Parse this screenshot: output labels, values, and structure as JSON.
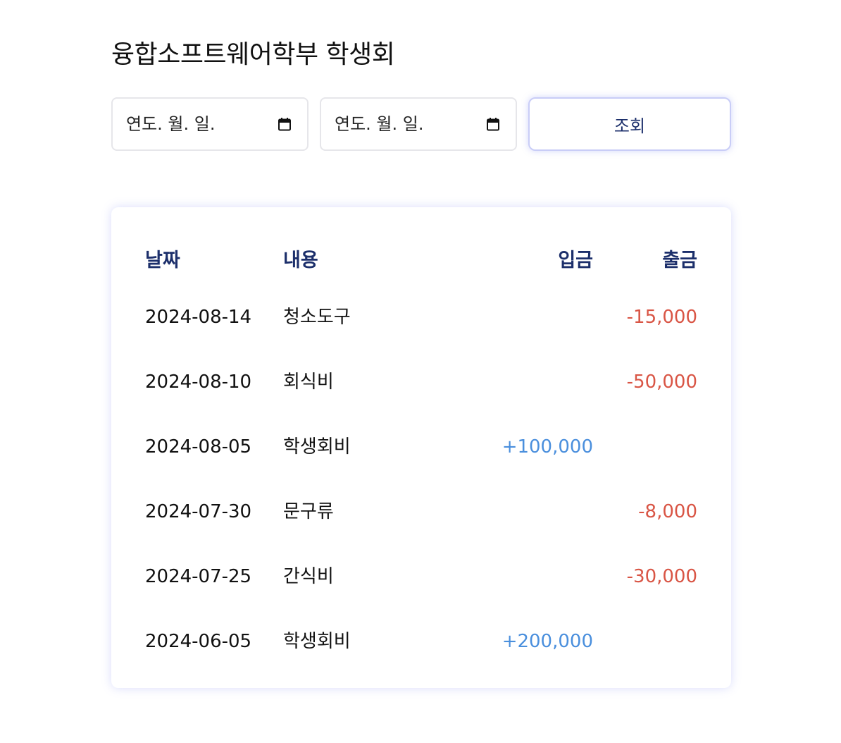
{
  "title": "융합소프트웨어학부 학생회",
  "filters": {
    "start_date_placeholder": "연도. 월. 일.",
    "end_date_placeholder": "연도. 월. 일.",
    "calendar_icon": "calendar-icon",
    "search_label": "조회"
  },
  "table": {
    "headers": {
      "date": "날짜",
      "description": "내용",
      "deposit": "입금",
      "withdrawal": "출금"
    },
    "rows": [
      {
        "date": "2024-08-14",
        "description": "청소도구",
        "deposit": "",
        "withdrawal": "-15,000"
      },
      {
        "date": "2024-08-10",
        "description": "회식비",
        "deposit": "",
        "withdrawal": "-50,000"
      },
      {
        "date": "2024-08-05",
        "description": "학생회비",
        "deposit": "+100,000",
        "withdrawal": ""
      },
      {
        "date": "2024-07-30",
        "description": "문구류",
        "deposit": "",
        "withdrawal": "-8,000"
      },
      {
        "date": "2024-07-25",
        "description": "간식비",
        "deposit": "",
        "withdrawal": "-30,000"
      },
      {
        "date": "2024-06-05",
        "description": "학생회비",
        "deposit": "+200,000",
        "withdrawal": ""
      }
    ]
  },
  "colors": {
    "header_text": "#1c2f6b",
    "deposit": "#4a8fdd",
    "withdrawal": "#d95545",
    "button_border": "#c9cdf7"
  }
}
